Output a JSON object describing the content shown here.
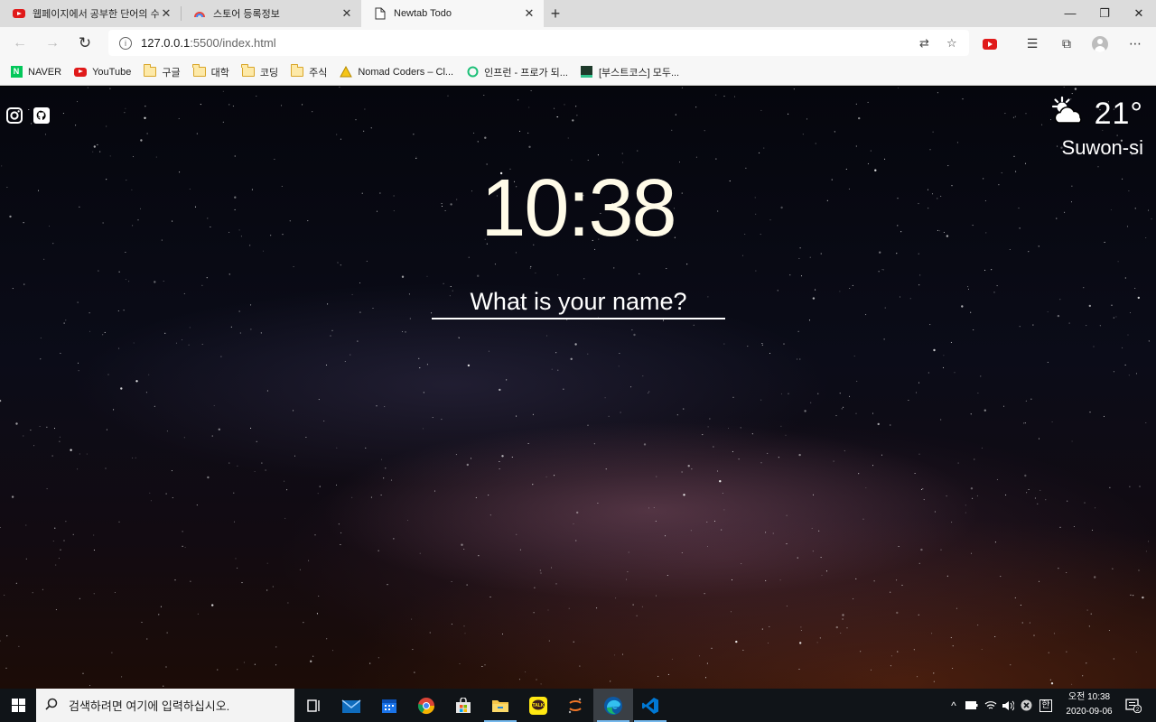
{
  "browser": {
    "tabs": [
      {
        "title": "웹페이지에서 공부한 단어의 수집",
        "icon": "youtube-favicon"
      },
      {
        "title": "스토어 등록정보",
        "icon": "chrome-webstore-favicon"
      },
      {
        "title": "Newtab Todo",
        "icon": "document-favicon",
        "active": true
      }
    ],
    "address": {
      "host": "127.0.0.1",
      "rest": ":5500/index.html"
    },
    "bookmarks": [
      {
        "label": "NAVER",
        "icon": "naver-icon"
      },
      {
        "label": "YouTube",
        "icon": "youtube-icon"
      },
      {
        "label": "구글",
        "icon": "folder-icon"
      },
      {
        "label": "대학",
        "icon": "folder-icon"
      },
      {
        "label": "코딩",
        "icon": "folder-icon"
      },
      {
        "label": "주식",
        "icon": "folder-icon"
      },
      {
        "label": "Nomad Coders – Cl...",
        "icon": "nomad-icon"
      },
      {
        "label": "인프런 - 프로가 되...",
        "icon": "inflearn-icon"
      },
      {
        "label": "[부스트코스] 모두...",
        "icon": "boostcourse-icon"
      }
    ]
  },
  "page": {
    "weather": {
      "temperature": "21°",
      "city": "Suwon-si",
      "icon": "partly-cloudy-icon"
    },
    "clock": "10:38",
    "name_placeholder": "What is your name?"
  },
  "taskbar": {
    "search_placeholder": "검색하려면 여기에 입력하십시오.",
    "time": "오전 10:38",
    "date": "2020-09-06",
    "notification_count": "2",
    "ime": "한"
  }
}
